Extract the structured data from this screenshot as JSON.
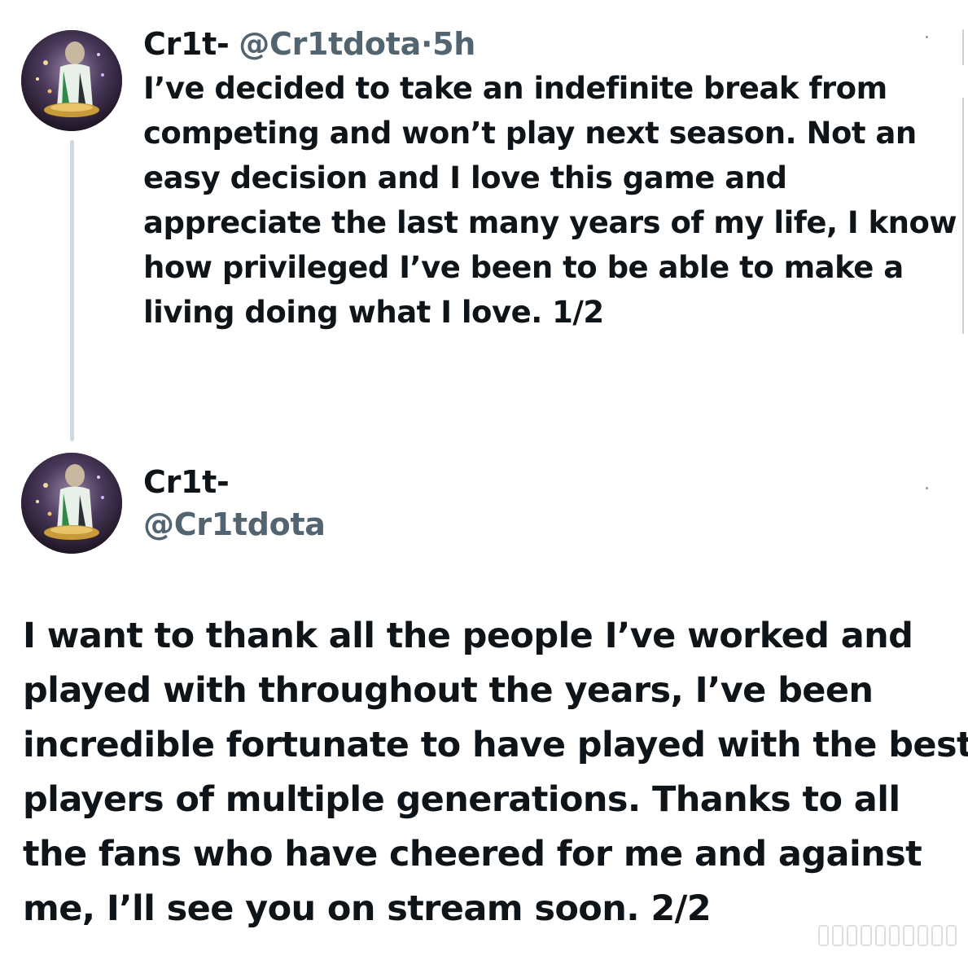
{
  "tweet1": {
    "display_name": "Cr1t-",
    "handle": "@Cr1tdota",
    "separator": "·",
    "time": "5h",
    "lines": [
      "I’ve decided to take an indefinite break from",
      "competing and won’t play next season. Not an",
      "easy decision and I love this game and",
      "appreciate the last many years of my life, I know",
      "how privileged I’ve been to be able to make a",
      "living doing what I love. 1/2"
    ],
    "avatar_icon": "profile-photo"
  },
  "tweet2": {
    "display_name": "Cr1t-",
    "handle": "@Cr1tdota",
    "lines": [
      "I want to thank all the people I’ve worked and",
      "played with throughout the years, I’ve been",
      "incredible fortunate to have played with the best",
      "players of multiple generations. Thanks to all",
      "the fans who have cheered for me and against",
      "me, I’ll see you on stream soon. 2/2"
    ],
    "avatar_icon": "profile-photo"
  },
  "colors": {
    "text_primary": "#0f1419",
    "text_secondary": "#536471",
    "thread_line": "#cfd9de",
    "background": "#ffffff"
  }
}
